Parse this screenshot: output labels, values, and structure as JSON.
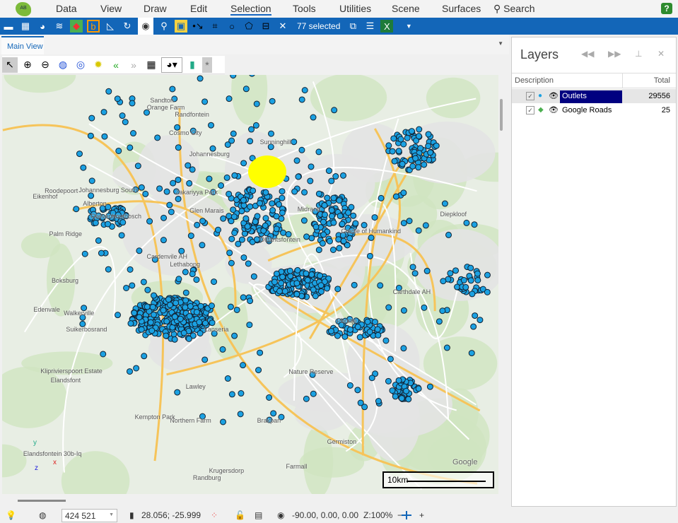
{
  "menu": {
    "items": [
      "Data",
      "View",
      "Draw",
      "Edit",
      "Selection",
      "Tools",
      "Utilities",
      "Scene",
      "Surfaces",
      "Search"
    ],
    "active": "Selection",
    "help": "?"
  },
  "toolbar": {
    "selected_label": "77 selected"
  },
  "tabs": {
    "main": "Main View"
  },
  "map": {
    "labels": [
      "Cradle of Humankind",
      "Midrand",
      "Olifantsfontein",
      "Northern Farm",
      "Lanseria",
      "Farmall",
      "Cosmo City",
      "Randburg",
      "Sandton",
      "Roodepoort",
      "Lethabong",
      "Kempton Park",
      "Krugersdorp",
      "Randfontein",
      "Johannesburg",
      "Johannesburg South",
      "Germiston",
      "Boksburg",
      "Brakpan",
      "Alberton",
      "Kliprivierspoort Estate",
      "Zakariyya Park",
      "Lawley",
      "Eikenhof",
      "Palm Ridge",
      "Walkerville",
      "Orange Farm",
      "Poortje",
      "Carthdale AH",
      "Cardenvile AH",
      "Elandsfontein 30b-Iq",
      "Diepkloof",
      "Olievenhoutbosch",
      "Glen Marais",
      "Elandsfont",
      "Sunninghill",
      "Edenvale",
      "Nature Reserve",
      "Suikerbosrand"
    ],
    "scale_label": "10km",
    "attribution": "Google",
    "axes": {
      "y": "y",
      "x": "x",
      "z": "z"
    },
    "dot_color": "#1ba1e2",
    "selection_color": "#ffff00"
  },
  "layers": {
    "title": "Layers",
    "col_description": "Description",
    "col_total": "Total",
    "rows": [
      {
        "name": "Outlets",
        "total": "29556",
        "selected": true
      },
      {
        "name": "Google Roads",
        "total": "25",
        "selected": false
      }
    ]
  },
  "status": {
    "scale": "424 521",
    "coords": "28.056; -25.999",
    "rotation": "-90.00, 0.00, 0.00",
    "zoom": "Z:100%"
  }
}
